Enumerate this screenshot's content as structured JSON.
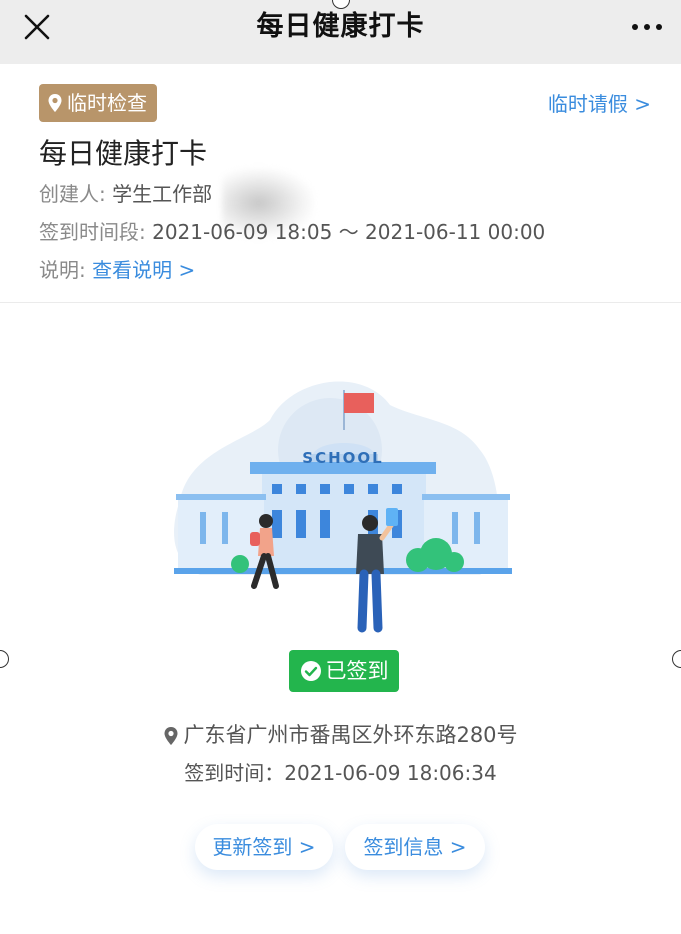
{
  "topbar": {
    "title": "每日健康打卡",
    "close_icon": "close-icon",
    "more_icon": "more-icon"
  },
  "card": {
    "tag_label": "临时检查",
    "tag_icon": "location-pin-icon",
    "leave_link": "临时请假 >",
    "title": "每日健康打卡",
    "creator_label": "创建人:",
    "creator_value": "学生工作部",
    "period_label": "签到时间段:",
    "period_value": "2021-06-09 18:05 ～ 2021-06-11 00:00",
    "desc_label": "说明:",
    "desc_link": "查看说明 >"
  },
  "illustration": {
    "school_text": "SCHOOL"
  },
  "status": {
    "badge_label": "已签到",
    "location": "广东省广州市番禺区外环东路280号",
    "sign_time": "签到时间：2021-06-09 18:06:34"
  },
  "actions": {
    "update_label": "更新签到 >",
    "info_label": "签到信息 >"
  },
  "colors": {
    "tag_bg": "#b8956a",
    "link_blue": "#3a8cde",
    "signed_green": "#23b54d",
    "topbar_bg": "#ededed"
  }
}
